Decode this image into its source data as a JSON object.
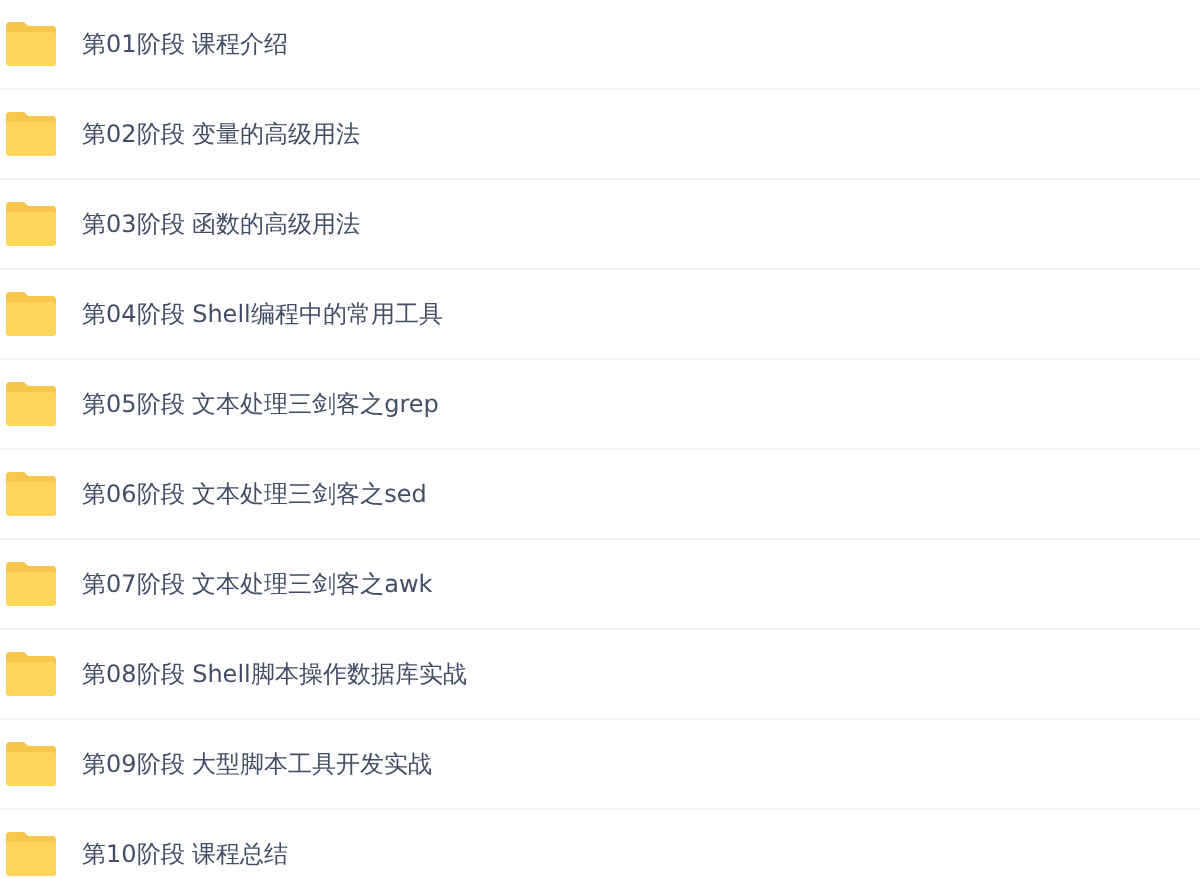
{
  "folders": [
    {
      "name": "第01阶段 课程介绍"
    },
    {
      "name": "第02阶段 变量的高级用法"
    },
    {
      "name": "第03阶段 函数的高级用法"
    },
    {
      "name": "第04阶段 Shell编程中的常用工具"
    },
    {
      "name": "第05阶段 文本处理三剑客之grep"
    },
    {
      "name": "第06阶段 文本处理三剑客之sed"
    },
    {
      "name": "第07阶段 文本处理三剑客之awk"
    },
    {
      "name": "第08阶段 Shell脚本操作数据库实战"
    },
    {
      "name": "第09阶段 大型脚本工具开发实战"
    },
    {
      "name": "第10阶段 课程总结"
    }
  ]
}
